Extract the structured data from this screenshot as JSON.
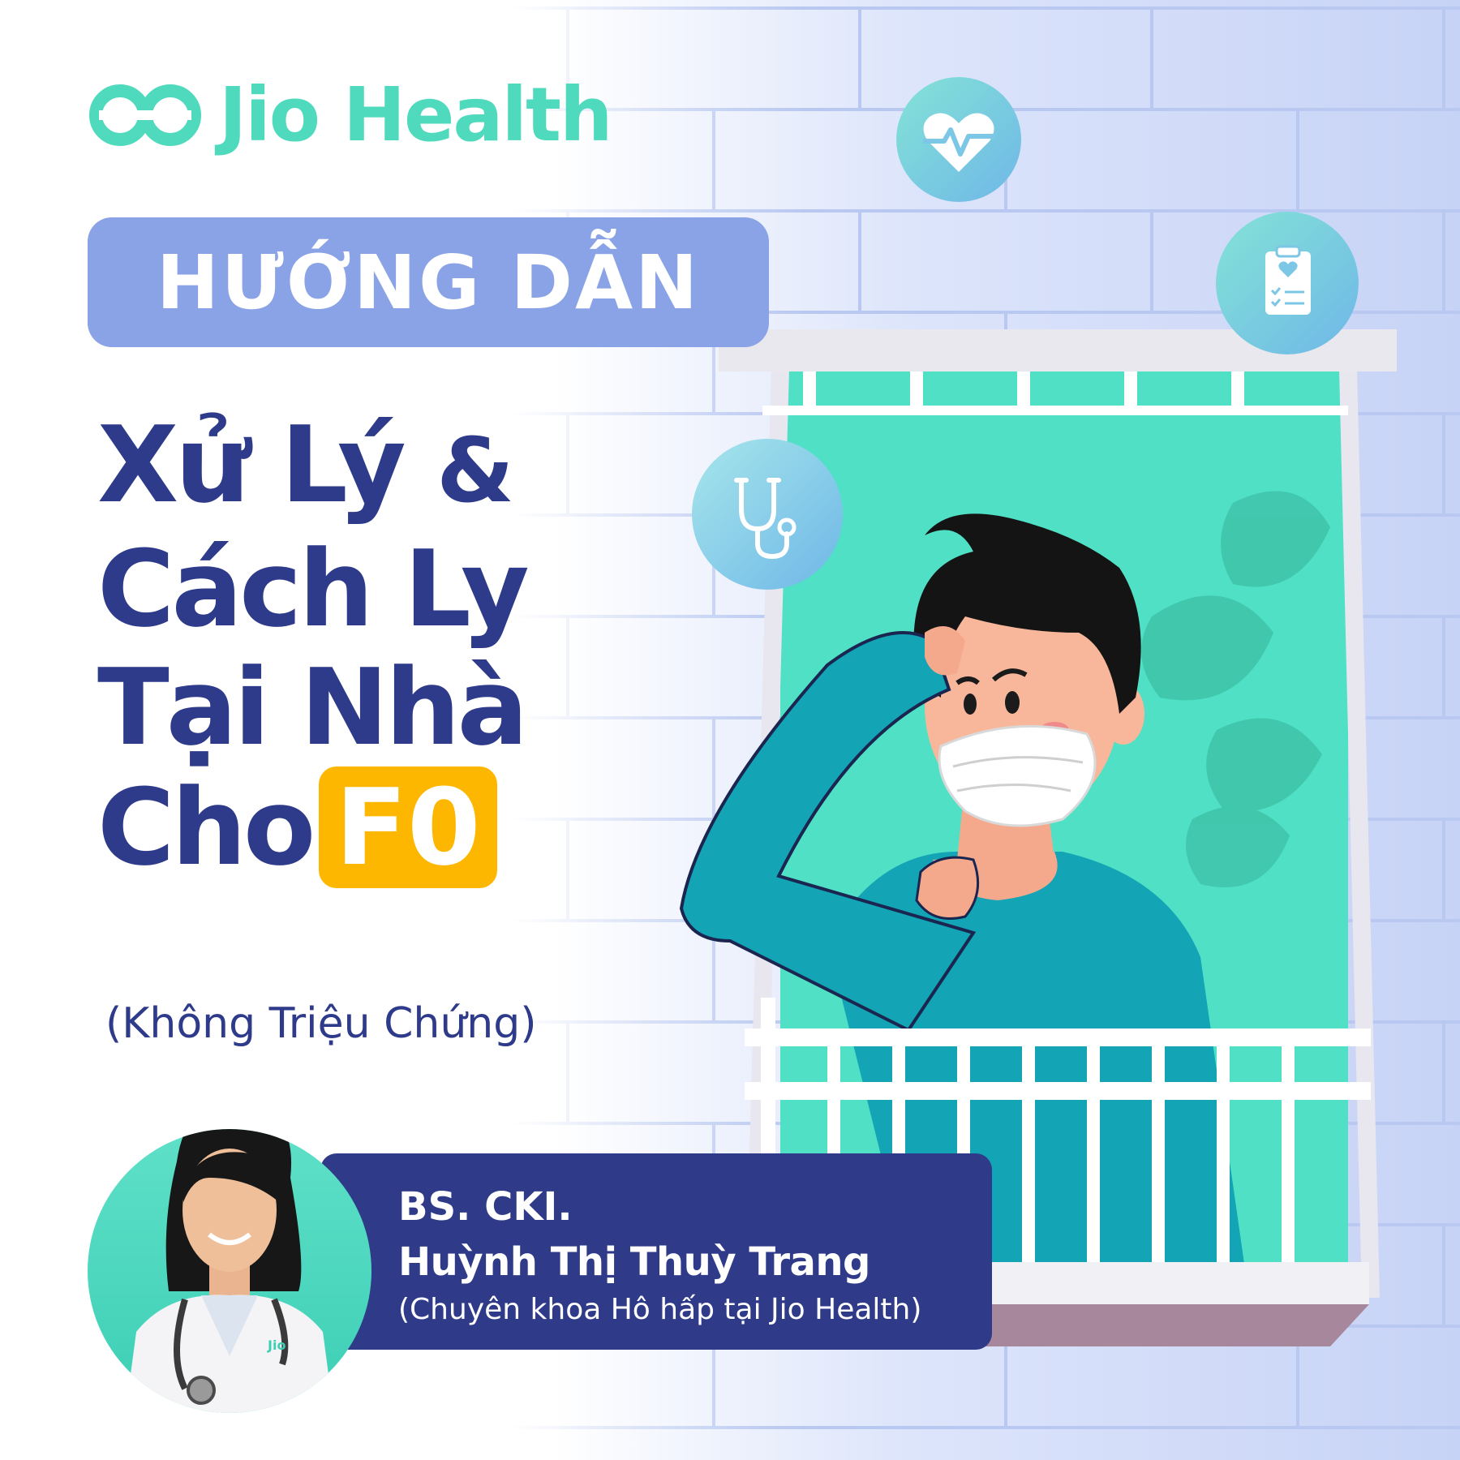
{
  "brand": {
    "name": "Jio Health",
    "color": "#4fd9bd"
  },
  "badge": {
    "label": "HƯỚNG DẪN",
    "color": "#8aa2e6"
  },
  "headline": {
    "line1": "Xử Lý",
    "ampersand": "&",
    "line2": "Cách Ly",
    "line3": "Tại Nhà",
    "line4": "Cho",
    "highlight": "F0",
    "color": "#2e3a8a",
    "highlight_color": "#fdb701"
  },
  "subtitle": "(Không Triệu Chứng)",
  "doctor": {
    "title": "BS. CKI.",
    "name": "Huỳnh Thị Thuỳ Trang",
    "specialty": "(Chuyên khoa Hô hấp tại Jio Health)",
    "coat_logo": "Jio"
  },
  "icons": [
    "heart-rate-icon",
    "clipboard-heart-icon",
    "stethoscope-icon"
  ]
}
